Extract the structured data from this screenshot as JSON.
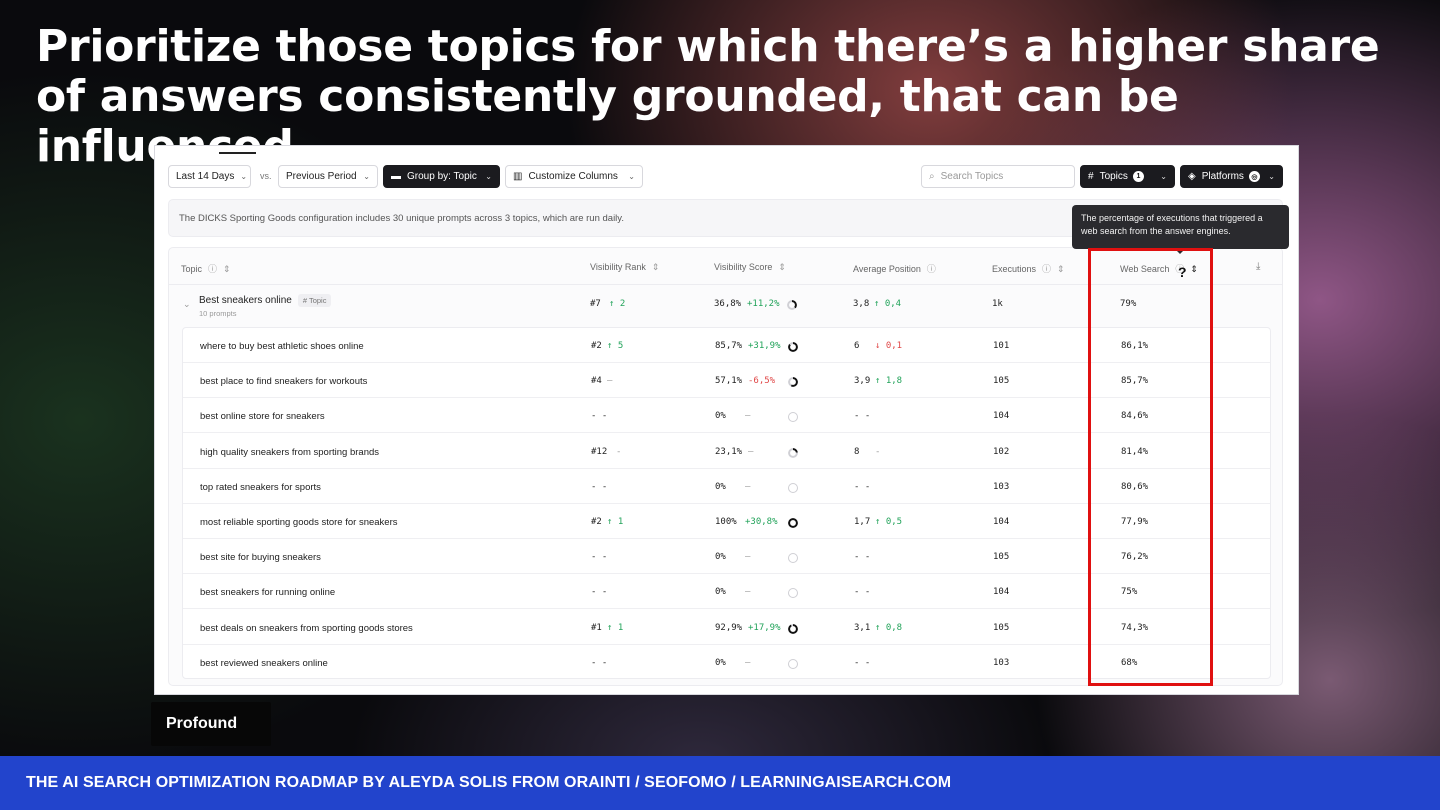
{
  "headline": "Prioritize those topics for which there’s a higher share of answers consistently grounded, that can be influenced",
  "toolbar": {
    "date_range": "Last 14 Days",
    "vs": "vs.",
    "compare": "Previous Period",
    "group_by": "Group by: Topic",
    "customize": "Customize Columns",
    "search_placeholder": "Search Topics",
    "topics": "Topics",
    "topics_count": "1",
    "platforms": "Platforms"
  },
  "info_text": "The DICKS Sporting Goods configuration includes 30 unique prompts across 3 topics, which are run daily.",
  "tooltip": "The percentage of executions that triggered a web search from the answer engines.",
  "columns": {
    "topic": "Topic",
    "visibility_rank": "Visibility Rank",
    "visibility_score": "Visibility Score",
    "average_position": "Average Position",
    "executions": "Executions",
    "web_search": "Web Search"
  },
  "topic_row": {
    "name": "Best sneakers online",
    "tag": "# Topic",
    "prompts": "10 prompts",
    "rank": "#7",
    "rank_delta": "↑ 2",
    "score": "36,8%",
    "score_delta": "+11,2%",
    "score_fill": 0.368,
    "position": "3,8",
    "position_delta": "↑ 0,4",
    "executions": "1k",
    "web_search": "79%"
  },
  "rows": [
    {
      "prompt": "where to buy best athletic shoes online",
      "rank": "#2",
      "rank_delta": "↑ 5",
      "rank_dir": "up",
      "score": "85,7%",
      "score_delta": "+31,9%",
      "score_dir": "up",
      "score_fill": 0.857,
      "position": "6",
      "position_delta": "↓ 0,1",
      "position_dir": "down",
      "executions": "101",
      "web_search": "86,1%"
    },
    {
      "prompt": "best place to find sneakers for workouts",
      "rank": "#4",
      "rank_delta": "–",
      "rank_dir": "muted",
      "score": "57,1%",
      "score_delta": "-6,5%",
      "score_dir": "down",
      "score_fill": 0.571,
      "position": "3,9",
      "position_delta": "↑ 1,8",
      "position_dir": "up",
      "executions": "105",
      "web_search": "85,7%"
    },
    {
      "prompt": "best online store for sneakers",
      "rank": "- -",
      "rank_delta": "",
      "rank_dir": "muted",
      "score": "0%",
      "score_delta": "–",
      "score_dir": "muted",
      "score_fill": 0,
      "position": "- -",
      "position_delta": "",
      "position_dir": "muted",
      "executions": "104",
      "web_search": "84,6%"
    },
    {
      "prompt": "high quality sneakers from sporting brands",
      "rank": "#12",
      "rank_delta": "-",
      "rank_dir": "muted",
      "score": "23,1%",
      "score_delta": "–",
      "score_dir": "muted",
      "score_fill": 0.231,
      "position": "8",
      "position_delta": "-",
      "position_dir": "muted",
      "executions": "102",
      "web_search": "81,4%"
    },
    {
      "prompt": "top rated sneakers for sports",
      "rank": "- -",
      "rank_delta": "",
      "rank_dir": "muted",
      "score": "0%",
      "score_delta": "–",
      "score_dir": "muted",
      "score_fill": 0,
      "position": "- -",
      "position_delta": "",
      "position_dir": "muted",
      "executions": "103",
      "web_search": "80,6%"
    },
    {
      "prompt": "most reliable sporting goods store for sneakers",
      "rank": "#2",
      "rank_delta": "↑ 1",
      "rank_dir": "up",
      "score": "100%",
      "score_delta": "+30,8%",
      "score_dir": "up",
      "score_fill": 1,
      "position": "1,7",
      "position_delta": "↑ 0,5",
      "position_dir": "up",
      "executions": "104",
      "web_search": "77,9%"
    },
    {
      "prompt": "best site for buying sneakers",
      "rank": "- -",
      "rank_delta": "",
      "rank_dir": "muted",
      "score": "0%",
      "score_delta": "–",
      "score_dir": "muted",
      "score_fill": 0,
      "position": "- -",
      "position_delta": "",
      "position_dir": "muted",
      "executions": "105",
      "web_search": "76,2%"
    },
    {
      "prompt": "best sneakers for running online",
      "rank": "- -",
      "rank_delta": "",
      "rank_dir": "muted",
      "score": "0%",
      "score_delta": "–",
      "score_dir": "muted",
      "score_fill": 0,
      "position": "- -",
      "position_delta": "",
      "position_dir": "muted",
      "executions": "104",
      "web_search": "75%"
    },
    {
      "prompt": "best deals on sneakers from sporting goods stores",
      "rank": "#1",
      "rank_delta": "↑ 1",
      "rank_dir": "up",
      "score": "92,9%",
      "score_delta": "+17,9%",
      "score_dir": "up",
      "score_fill": 0.929,
      "position": "3,1",
      "position_delta": "↑ 0,8",
      "position_dir": "up",
      "executions": "105",
      "web_search": "74,3%"
    },
    {
      "prompt": "best reviewed sneakers online",
      "rank": "- -",
      "rank_delta": "",
      "rank_dir": "muted",
      "score": "0%",
      "score_delta": "–",
      "score_dir": "muted",
      "score_fill": 0,
      "position": "- -",
      "position_delta": "",
      "position_dir": "muted",
      "executions": "103",
      "web_search": "68%"
    }
  ],
  "help_mark": "?",
  "brand": "Profound",
  "footer": "THE AI SEARCH OPTIMIZATION ROADMAP BY ALEYDA SOLIS FROM ORAINTI / SEOFOMO / LEARNINGAISEARCH.COM",
  "colors": {
    "accent_red": "#e01010",
    "footer_blue": "#2244cc",
    "up_green": "#22a35a",
    "down_red": "#e04848"
  }
}
